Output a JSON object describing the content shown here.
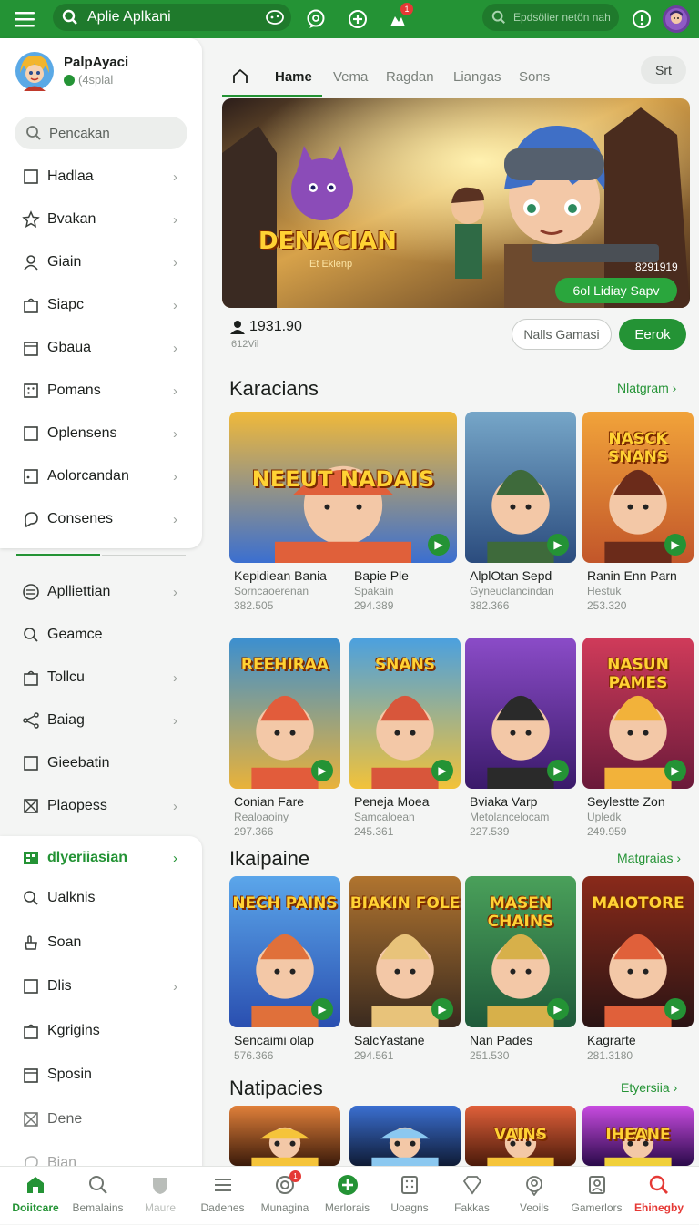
{
  "topbar": {
    "search_text": "Aplie Aplkani",
    "search2_placeholder": "Epdsölier netön nah",
    "notif_count": "1"
  },
  "profile": {
    "name": "PalpAyaci",
    "status": "(4splal"
  },
  "sidebar": {
    "search_placeholder": "Pencakan",
    "group1": [
      "Hadlaa",
      "Bvakan",
      "Giain",
      "Siapc",
      "Gbaua",
      "Pomans",
      "Oplensens",
      "Aolorcandan",
      "Consenes"
    ],
    "group2": [
      "Aplliettian",
      "Geamce",
      "Tollcu",
      "Baiag",
      "Gieebatin",
      "Plaopess"
    ],
    "group3_title": "dlyeriiasian",
    "group3": [
      "Ualknis",
      "Soan",
      "Dlis",
      "Kgrigins",
      "Sposin",
      "Dene",
      "Bian"
    ]
  },
  "tabs": [
    "Hame",
    "Vema",
    "Ragdan",
    "Liangas",
    "Sons"
  ],
  "sort_label": "Srt",
  "hero": {
    "title": "DENACIAN",
    "subtitle": "Et Eklenp",
    "count": "8291919",
    "cta": "6ol Lidiay Sapv",
    "stat": "1931.90",
    "stat_sub": "612Vil",
    "btn_secondary": "Nalls Gamasi",
    "btn_primary": "Eerok"
  },
  "sections": [
    {
      "title": "Karacians",
      "more": "Nlatgram"
    },
    {
      "title": "Ikaipaine",
      "more": "Matgraias"
    },
    {
      "title": "Natipacies",
      "more": "Etyersiia"
    }
  ],
  "row1": [
    {
      "name": "Kepidiean Bania",
      "sub": "Sorncaoerenan",
      "count": "382.505",
      "art": "NEEUT NADAIS"
    },
    {
      "name": "Bapie Ple",
      "sub": "Spakain",
      "count": "294.389",
      "art": ""
    },
    {
      "name": "AlplOtan Sepd",
      "sub": "Gyneuclancindan",
      "count": "382.366",
      "art": ""
    },
    {
      "name": "Ranin Enn Parn",
      "sub": "Hestuk",
      "count": "253.320",
      "art": "NASCK SNANS"
    }
  ],
  "row2": [
    {
      "name": "Conian Fare",
      "sub": "Realoaoiny",
      "count": "297.366",
      "art": "REEHIRAA"
    },
    {
      "name": "Peneja Moea",
      "sub": "Samcaloean",
      "count": "245.361",
      "art": "SNANS"
    },
    {
      "name": "Bviaka Varp",
      "sub": "Metolancelocam",
      "count": "227.539",
      "art": ""
    },
    {
      "name": "Seylestte Zon",
      "sub": "Upledk",
      "count": "249.959",
      "art": "NASUN PAMES"
    }
  ],
  "row3": [
    {
      "name": "Sencaimi olap",
      "sub": "",
      "count": "576.366",
      "art": "NECH PAINS"
    },
    {
      "name": "SalcYastane",
      "sub": "",
      "count": "294.561",
      "art": "BIAKIN FOLE"
    },
    {
      "name": "Nan Pades",
      "sub": "",
      "count": "251.530",
      "art": "MASEN CHAINS"
    },
    {
      "name": "Kagrarte",
      "sub": "",
      "count": "281.3180",
      "art": "MAIOTORE"
    }
  ],
  "row4": [
    {
      "art": ""
    },
    {
      "art": ""
    },
    {
      "art": "VAINS"
    },
    {
      "art": "IHEANE"
    }
  ],
  "bottom_nav": [
    "Doiitcare",
    "Bemalains",
    "Maure",
    "Dadenes",
    "Munagina",
    "Merlorais",
    "Uoagns",
    "Fakkas",
    "Veoils",
    "Gamerlors",
    "Ehinegby"
  ],
  "colors": {
    "accent": "#249335",
    "badge": "#e53935",
    "active_red": "#e53935"
  }
}
